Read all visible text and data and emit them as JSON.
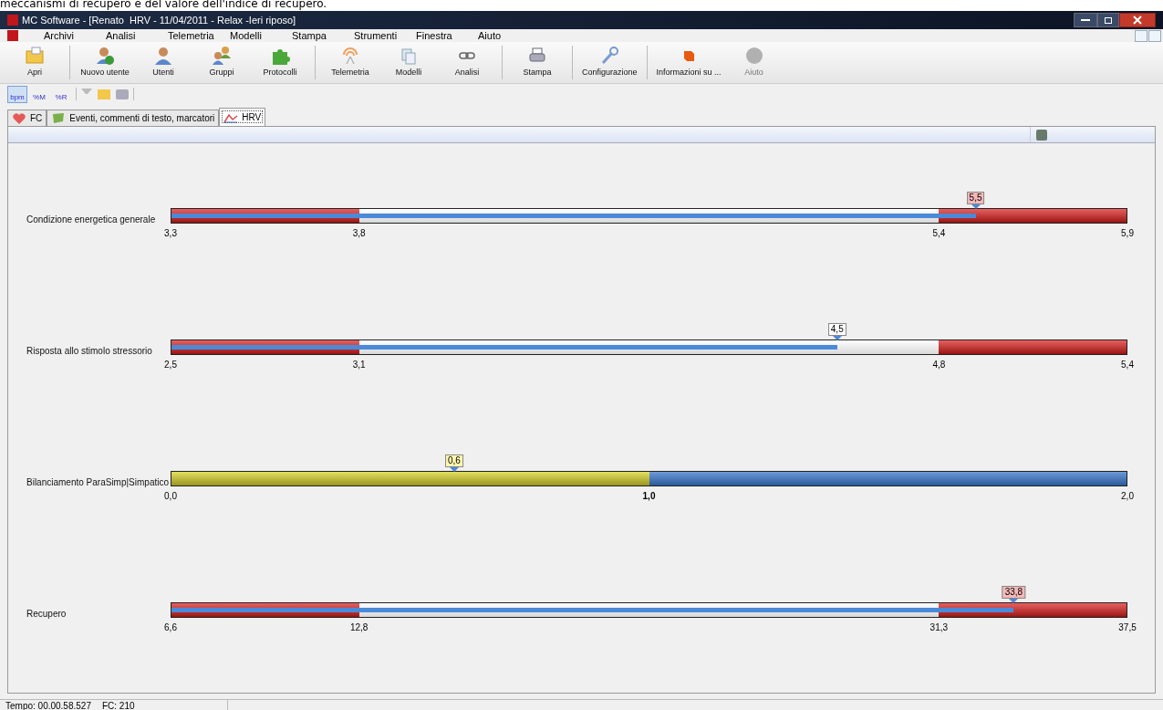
{
  "caption": "meccanismi di recupero e del valore dell'indice di recupero.",
  "window": {
    "title": "MC Software - [Renato  HRV - 11/04/2011 - Relax -Ieri riposo]"
  },
  "menu": [
    "Archivi",
    "Analisi",
    "Telemetria",
    "Modelli",
    "Stampa",
    "Strumenti",
    "Finestra",
    "Aiuto"
  ],
  "toolbar": [
    {
      "label": "Apri",
      "disabled": false
    },
    {
      "label": "Nuovo utente",
      "disabled": false
    },
    {
      "label": "Utenti",
      "disabled": false
    },
    {
      "label": "Gruppi",
      "disabled": false
    },
    {
      "label": "Protocolli",
      "disabled": false
    },
    {
      "label": "Telemetria",
      "disabled": false
    },
    {
      "label": "Modelli",
      "disabled": false
    },
    {
      "label": "Analisi",
      "disabled": false
    },
    {
      "label": "Stampa",
      "disabled": false
    },
    {
      "label": "Configurazione",
      "disabled": false
    },
    {
      "label": "Informazioni su ...",
      "disabled": false
    },
    {
      "label": "Aiuto",
      "disabled": true
    }
  ],
  "small_toolbar": [
    {
      "label": "bpm",
      "selected": true
    },
    {
      "label": "%M",
      "selected": false
    },
    {
      "label": "%R",
      "selected": false
    }
  ],
  "tabs": [
    {
      "label": "FC",
      "selected": false
    },
    {
      "label": "Eventi, commenti di testo, marcatori",
      "selected": false
    },
    {
      "label": "HRV",
      "selected": true
    }
  ],
  "bars": [
    {
      "kind": "zones",
      "label": "Condizione energetica generale",
      "ticks": [
        "3,3",
        "3,8",
        "5,4",
        "5,9"
      ],
      "value": "5,5",
      "level": 0.842,
      "out_of_range": true
    },
    {
      "kind": "zones",
      "label": "Risposta allo stimolo stressorio",
      "ticks": [
        "2,5",
        "3,1",
        "4,8",
        "5,4"
      ],
      "value": "4,5",
      "level": 0.697,
      "out_of_range": false
    },
    {
      "kind": "split",
      "label": "Bilanciamento ParaSimp|Simpatico",
      "ticks": [
        "0,0",
        "1,0",
        "2,0"
      ],
      "value": "0,6",
      "level": 0.296
    },
    {
      "kind": "zones",
      "label": "Recupero",
      "ticks": [
        "6,6",
        "12,8",
        "31,3",
        "37,5"
      ],
      "value": "33,8",
      "level": 0.882,
      "out_of_range": true
    }
  ],
  "status_bar": {
    "time": "Tempo: 00.00.58.527",
    "hr": "FC: 210"
  }
}
